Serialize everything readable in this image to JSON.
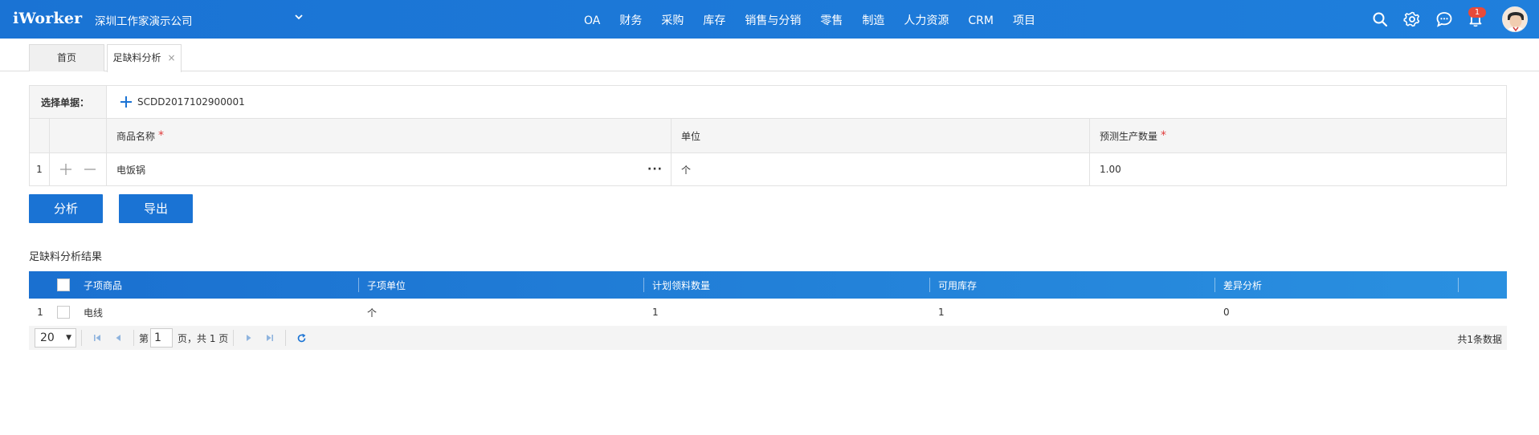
{
  "header": {
    "logo": "iWorker",
    "company": "深圳工作家演示公司",
    "nav": [
      "OA",
      "财务",
      "采购",
      "库存",
      "销售与分销",
      "零售",
      "制造",
      "人力资源",
      "CRM",
      "项目"
    ],
    "notification_count": "1"
  },
  "tabs": {
    "home": "首页",
    "active": "足缺料分析",
    "close": "×"
  },
  "form": {
    "select_label": "选择单据：",
    "order_no": "SCDD2017102900001",
    "columns": {
      "name": "商品名称",
      "unit": "单位",
      "qty": "预测生产数量",
      "required_mark": "*"
    },
    "row": {
      "idx": "1",
      "name": "电饭锅",
      "more": "···",
      "unit": "个",
      "qty": "1.00"
    }
  },
  "buttons": {
    "analyze": "分析",
    "export": "导出"
  },
  "result": {
    "title": "足缺料分析结果",
    "columns": [
      "子项商品",
      "子项单位",
      "计划领料数量",
      "可用库存",
      "差异分析"
    ],
    "rows": [
      {
        "idx": "1",
        "item": "电线",
        "unit": "个",
        "planned": "1",
        "stock": "1",
        "diff": "0"
      }
    ]
  },
  "pager": {
    "page_size": "20",
    "page_prefix": "第",
    "page": "1",
    "page_suffix": "页，共 1 页",
    "total": "共1条数据"
  },
  "colors": {
    "primary": "#1a73d4",
    "required": "#e03c3c",
    "badge": "#e84a3a"
  }
}
